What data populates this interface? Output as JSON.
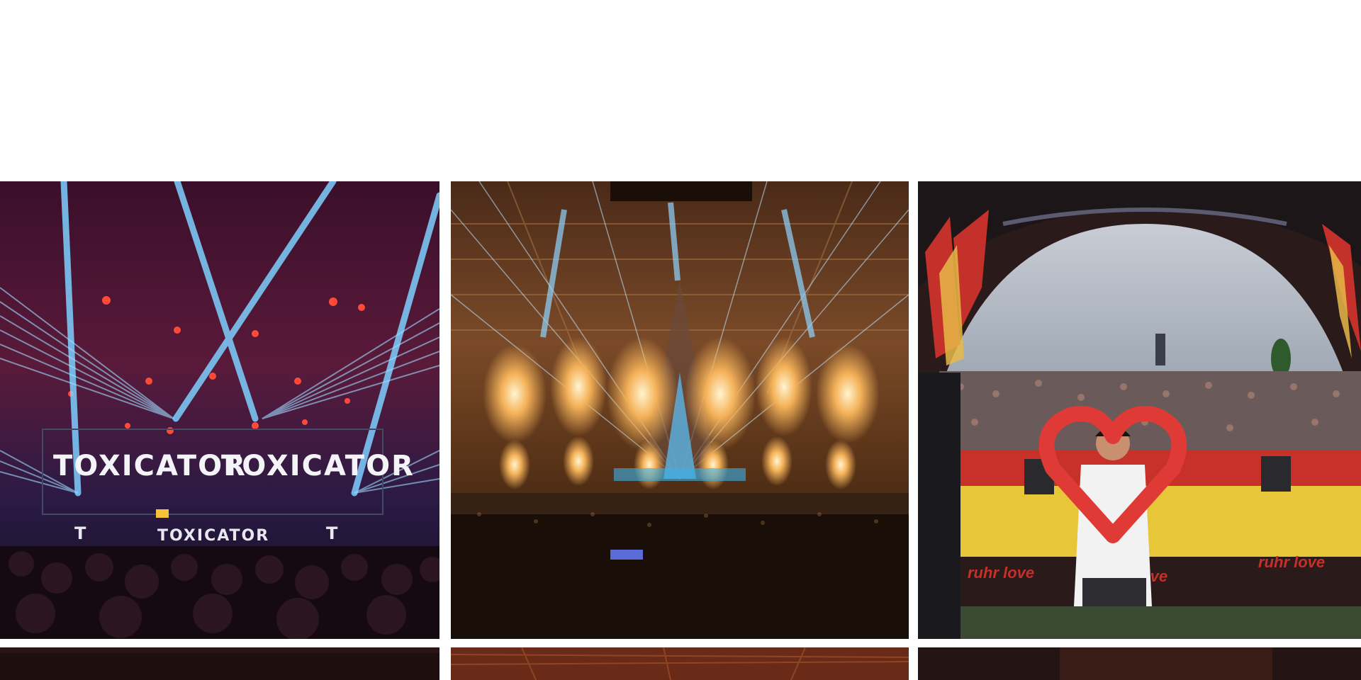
{
  "gallery": {
    "tiles": [
      {
        "id": "toxicator",
        "icon": "photo-laser-show",
        "logo_left": "TOXICATOR",
        "logo_right": "TOXICATOR",
        "logo_small": "TOXICATOR"
      },
      {
        "id": "pyro-hall",
        "icon": "photo-pyro-stage"
      },
      {
        "id": "ruhr-love",
        "icon": "photo-festival-heart",
        "banner_1": "ruhr love",
        "banner_2": "ruhr love",
        "banner_3": "ruhr love"
      },
      {
        "id": "row2-left",
        "icon": "photo-partial"
      },
      {
        "id": "row2-middle",
        "icon": "photo-partial"
      },
      {
        "id": "row2-right",
        "icon": "photo-partial"
      }
    ]
  },
  "colors": {
    "background": "#ffffff",
    "laser_blue": "#6fc8ff",
    "stage_red": "#e0302a",
    "pyro_orange": "#f2a24a",
    "banner_yellow": "#f2cf3a"
  }
}
